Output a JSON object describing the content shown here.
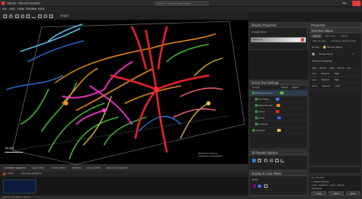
{
  "window": {
    "title": "Vaa3D - NeuroVisualizer"
  },
  "menu": {
    "items": [
      "File",
      "Edit",
      "View",
      "Window",
      "Help"
    ]
  },
  "toolbar": {
    "right_label": "Target:"
  },
  "search": {
    "placeholder": "Search ... Preview Graph Viewer"
  },
  "viewport": {
    "scale": "50 µm",
    "info": "3D Neuron Tracing\nInteractive Visualization"
  },
  "bottom_tabs": [
    "Animation Sequence",
    "Layer Editor",
    "Toolbar Editor",
    "Statistics",
    "Camera Editor",
    "Interactive Subsector"
  ],
  "bottom_tool": {
    "label_a": "Action",
    "label_b": "Auto Play Sequence"
  },
  "statusbar": {
    "text": "Ready  |  12 objects  |  54 fps"
  },
  "display_panel": {
    "title": "Display Properties",
    "label": "Display Name",
    "item": "Filaments"
  },
  "scene_panel": {
    "title": "Scene Tree Settings",
    "col_a": "Groups",
    "col_b": "Visible",
    "col_c": "Object",
    "rows": [
      "Filaments Group",
      "Dendrites",
      "Branches Set",
      "Axons",
      "Soma",
      "Subtrees"
    ],
    "last": "Selected"
  },
  "render_panel": {
    "title": "3D Render Options"
  },
  "bright_panel": {
    "title": "Display & Color Mode",
    "label": "Tones"
  },
  "side_panel": {
    "title": "Properties",
    "label": "No selection",
    "line_a": "1. Object Tracing",
    "line_b": "Color - Gradient - Color - Export",
    "line_c": "Add Mode"
  },
  "properties": {
    "title": "Selected Object",
    "tabs": [
      "Setting",
      "Path Color",
      "Tracer"
    ],
    "subtabs": [
      "Fiber Groups",
      "Display in selected cells"
    ],
    "render_label": "Render",
    "render_value": "Neurite Object",
    "mode_label": "Render Mode",
    "mode_value": "?",
    "section": "Filament Properties",
    "columns": [
      "Type",
      "Render",
      "Type",
      "Render",
      "Rig"
    ],
    "rows": [
      {
        "name": "Line",
        "val1": "Medium",
        "val2": "High"
      },
      {
        "name": "Line",
        "val1": "Medium",
        "val2": "High"
      },
      {
        "name": "Cone",
        "val1": "Medium",
        "val2": "High"
      }
    ],
    "footer_a": "Load",
    "footer_b": "Next",
    "footer_c": "Stop"
  },
  "colors": {
    "accent": "#e53935",
    "panel": "#202020",
    "selection": "#2e3b4c"
  }
}
